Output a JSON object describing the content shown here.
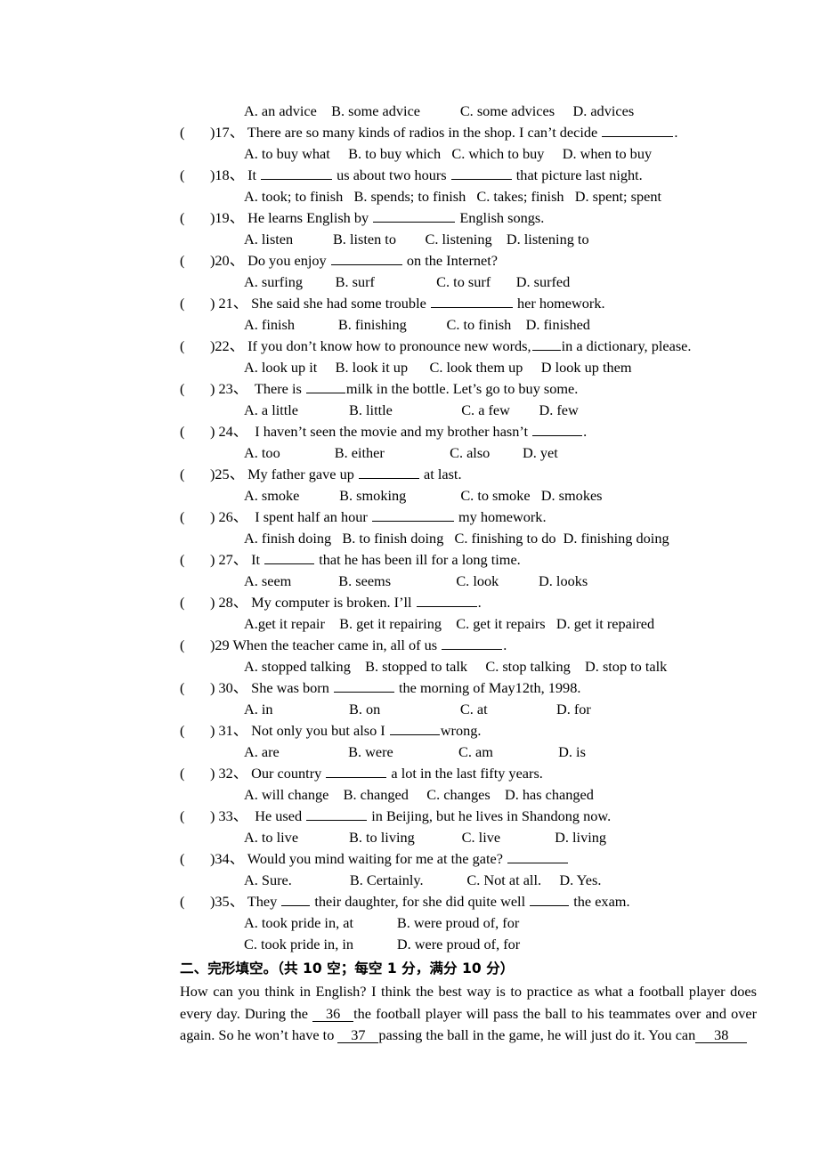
{
  "document": {
    "type": "english-exam-paper",
    "page_background": "#ffffff",
    "text_color": "#000000"
  },
  "orphan_options_line": {
    "a": "A. an advice",
    "b": "B. some advice",
    "c": "C. some advices",
    "d": "D. advices"
  },
  "multiple_choice": {
    "questions": [
      {
        "paren": "(",
        "number": ")17、",
        "stem_before": " There are so many kinds of radios in the shop. I can’t decide ",
        "blank": "w5",
        "stem_after": ".",
        "options_line": "A. to buy what     B. to buy which   C. which to buy     D. when to buy"
      },
      {
        "paren": "(",
        "number": ")18、",
        "stem_before": " It ",
        "blank": "w5",
        "stem_mid": " us about two hours ",
        "blank2": "w4",
        "stem_after": " that picture last night.",
        "options_line": "A. took; to finish   B. spends; to finish   C. takes; finish   D. spent; spent"
      },
      {
        "paren": "(",
        "number": ")19、",
        "stem_before": " He learns English by ",
        "blank": "w6",
        "stem_after": " English songs.",
        "options_line": "A. listen           B. listen to        C. listening    D. listening to"
      },
      {
        "paren": "(",
        "number": ")20、",
        "stem_before": " Do you enjoy ",
        "blank": "w5",
        "stem_after": " on the Internet?",
        "options_line": "A. surfing         B. surf                 C. to surf       D. surfed"
      },
      {
        "paren": "(",
        "number": ") 21、",
        "stem_before": " She said she had some trouble ",
        "blank": "w6",
        "stem_after": " her homework.",
        "options_line": "A. finish            B. finishing           C. to finish    D. finished"
      },
      {
        "paren": "(",
        "number": ")22、",
        "stem_before": " If you don’t know how to pronounce new words,",
        "blank": "w1",
        "stem_after": "in a dictionary, please.",
        "options_line": "A. look up it     B. look it up      C. look them up     D look up them"
      },
      {
        "paren": "(",
        "number": ") 23、",
        "stem_before": "  There is ",
        "blank": "w2",
        "stem_after": "milk in the bottle. Let’s go to buy some.",
        "options_line": "A. a little              B. little                   C. a few        D. few"
      },
      {
        "paren": "(",
        "number": ") 24、",
        "stem_before": "  I haven’t seen the movie and my brother hasn’t ",
        "blank": "w3",
        "stem_after": ".",
        "options_line": "A. too               B. either                  C. also         D. yet"
      },
      {
        "paren": "(",
        "number": ")25、",
        "stem_before": " My father gave up ",
        "blank": "w4",
        "stem_after": " at last.",
        "options_line": "A. smoke           B. smoking               C. to smoke   D. smokes"
      },
      {
        "paren": "(",
        "number": ") 26、",
        "stem_before": "  I spent half an hour ",
        "blank": "w6",
        "stem_after": " my homework.",
        "options_line": "A. finish doing   B. to finish doing   C. finishing to do  D. finishing doing"
      },
      {
        "paren": "(",
        "number": ") 27、",
        "stem_before": " It ",
        "blank": "w3",
        "stem_after": " that he has been ill for a long time.",
        "options_line": "A. seem             B. seems                  C. look           D. looks"
      },
      {
        "paren": "(",
        "number": ") 28、",
        "stem_before": " My computer is broken. I’ll ",
        "blank": "w4",
        "stem_after": ".",
        "options_line": "A.get it repair    B. get it repairing    C. get it repairs   D. get it repaired"
      },
      {
        "paren": "(",
        "number": ")29",
        "stem_before": " When the teacher came in, all of us ",
        "blank": "w4",
        "stem_after": ".",
        "options_line": "A. stopped talking    B. stopped to talk     C. stop talking    D. stop to talk"
      },
      {
        "paren": "(",
        "number": ") 30、",
        "stem_before": " She was born ",
        "blank": "w4",
        "stem_after": " the morning of May12th, 1998.",
        "options_line": "A. in                     B. on                      C. at                   D. for"
      },
      {
        "paren": "(",
        "number": ") 31、",
        "stem_before": " Not only you but also I ",
        "blank": "w3",
        "stem_after": "wrong.",
        "options_line": "A. are                   B. were                  C. am                  D. is"
      },
      {
        "paren": "(",
        "number": ") 32、",
        "stem_before": " Our country ",
        "blank": "w4",
        "stem_after": " a lot in the last fifty years.",
        "options_line": "A. will change    B. changed     C. changes    D. has changed"
      },
      {
        "paren": "(",
        "number": ") 33、",
        "stem_before": "  He used ",
        "blank": "w4",
        "stem_after": " in Beijing, but he lives in Shandong now.",
        "options_line": "A. to live              B. to living             C. live               D. living"
      },
      {
        "paren": "(",
        "number": ")34、",
        "stem_before": " Would you mind waiting for me at the gate? ",
        "blank": "w4",
        "stem_after": "",
        "options_line": "A. Sure.                B. Certainly.            C. Not at all.     D. Yes."
      },
      {
        "paren": "(",
        "number": ")35、",
        "stem_before": " They ",
        "blank": "w1",
        "stem_mid": " their daughter, for she did quite well ",
        "blank2": "w2",
        "stem_after": " the exam.",
        "options_line": "A. took pride in, at            B. were proud of, for",
        "options_line2": "C. took pride in, in            D. were proud of, for"
      }
    ]
  },
  "cloze_section": {
    "heading": "二、完形填空。（共 10 空；每空 1 分，满分 10 分）",
    "passage_parts": {
      "p1": "How can you think in English? I think the best way is to practice as what a football player does every day. During the ",
      "gap36": "36",
      "p2": "the football player will pass the ball to his teammates over and over again. So he won’t have to ",
      "gap37": "37",
      "p3": "passing the ball in the game, he will just do it. You can",
      "gap38": "38"
    }
  }
}
